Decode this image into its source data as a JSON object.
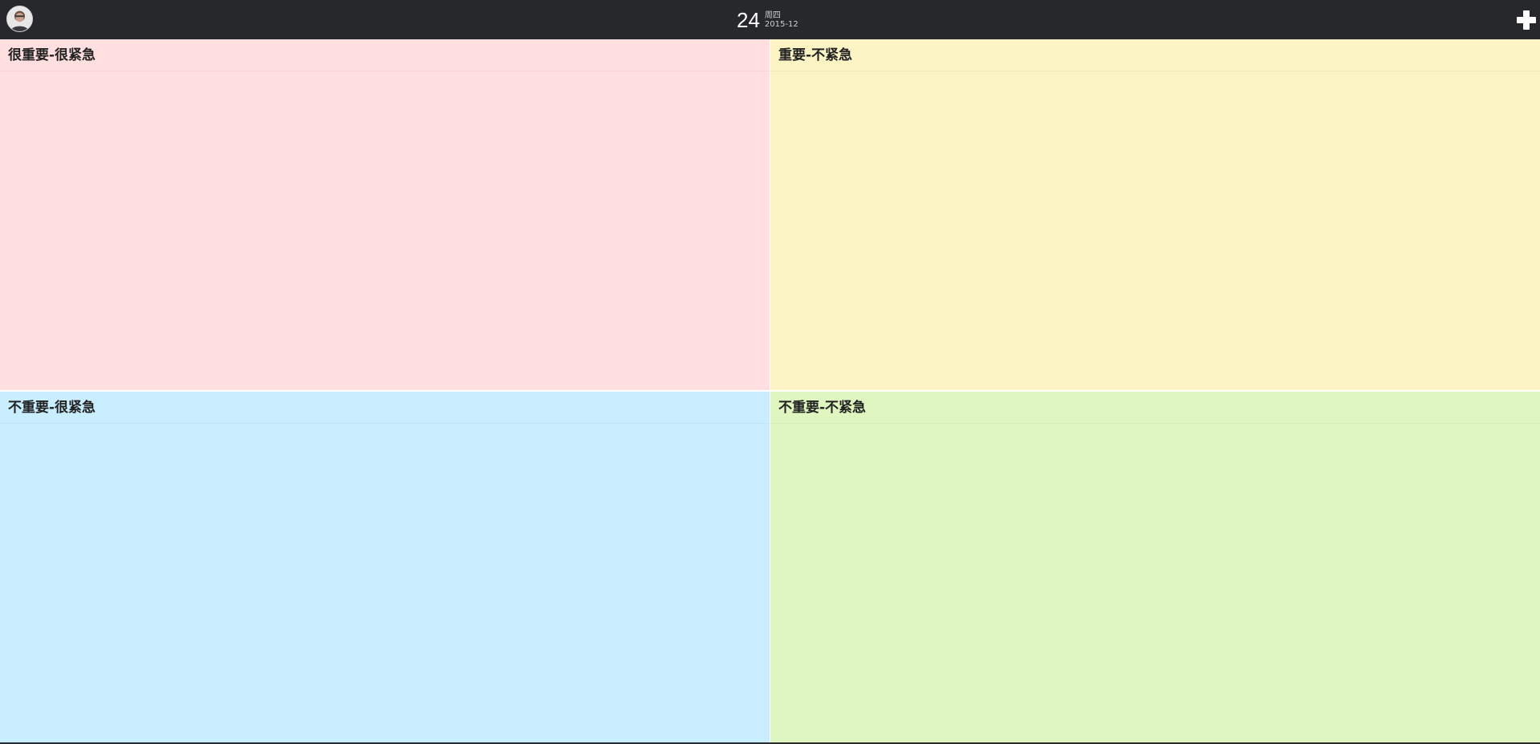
{
  "header": {
    "avatar_icon": "user-avatar-icon",
    "date": {
      "day": "24",
      "weekday": "周四",
      "year_month": "2015-12"
    },
    "add_icon": "plus-icon"
  },
  "quadrants": [
    {
      "title": "很重要-很紧急",
      "color": "#ffdfdf"
    },
    {
      "title": "重要-不紧急",
      "color": "#fcf4c5"
    },
    {
      "title": "不重要-很紧急",
      "color": "#c9eeff"
    },
    {
      "title": "不重要-不紧急",
      "color": "#e0f6c0"
    }
  ]
}
